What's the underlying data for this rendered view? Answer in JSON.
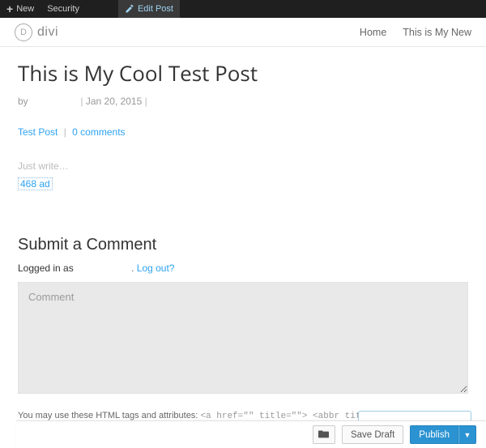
{
  "adminbar": {
    "new_label": "New",
    "security_label": "Security",
    "edit_label": "Edit Post"
  },
  "site": {
    "logo_letter": "D",
    "logo_text": "divi"
  },
  "nav": {
    "items": [
      "Home",
      "This is My New"
    ]
  },
  "post": {
    "title": "This is My Cool Test Post",
    "by_label": "by",
    "date": "Jan 20, 2015",
    "category": "Test Post",
    "comments_label": "0 comments",
    "body_placeholder": "Just write…",
    "ad468": "468 ad"
  },
  "comments": {
    "heading": "Submit a Comment",
    "loggedin_prefix": "Logged in as",
    "logout_label": "Log out?",
    "textarea_placeholder": "Comment",
    "allowed_prefix": "You may use these HTML tags and attributes:",
    "allowed_tags": "<a href=\"\" title=\"\"> <abbr title=\"\"> <acronym title=\"\"> <b> <blockquote cite=\"\"> <cite> <code> <del datetime=\"\"> <em> <i> <q cite=\"\"> <strike> <strong>"
  },
  "pubbar": {
    "savedraft": "Save Draft",
    "publish": "Publish",
    "caret": "▼"
  }
}
